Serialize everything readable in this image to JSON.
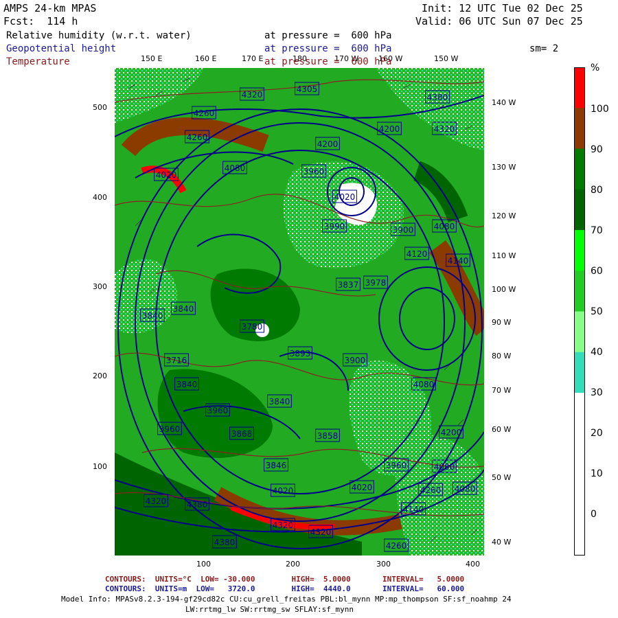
{
  "header": {
    "model": "AMPS 24-km MPAS",
    "fcst": "Fcst:  114 h",
    "init": "Init: 12 UTC Tue 02 Dec 25",
    "valid": "Valid: 06 UTC Sun 07 Dec 25",
    "rh_label": "Relative humidity (w.r.t. water)",
    "rh_level": "at pressure =  600 hPa",
    "gh_label": "Geopotential height",
    "gh_level": "at pressure =  600 hPa",
    "smooth": "sm= 2",
    "t_label": "Temperature",
    "t_level": "at pressure =  600 hPa"
  },
  "top_lon_labels": [
    "150 E",
    "160 E",
    "170 E",
    "180",
    "170 W",
    "160 W",
    "150 W"
  ],
  "right_lon_labels": [
    "140 W",
    "130 W",
    "120 W",
    "110 W",
    "100 W",
    "90 W",
    "80 W",
    "70 W",
    "60 W",
    "50 W",
    "40 W"
  ],
  "y_axis_labels": [
    "500",
    "400",
    "300",
    "200",
    "100"
  ],
  "x_axis_labels": [
    "100",
    "200",
    "300",
    "400"
  ],
  "height_labels": [
    "4320",
    "4305",
    "4380",
    "4260",
    "4200",
    "4320",
    "4260",
    "4200",
    "4020",
    "4080",
    "3960",
    "4020",
    "3990",
    "3900",
    "4080",
    "4120",
    "4140",
    "3840",
    "3780",
    "3978",
    "3837",
    "3840",
    "3716",
    "3840",
    "3893",
    "3900",
    "4080",
    "3840",
    "3960",
    "3960",
    "3868",
    "3858",
    "3846",
    "3960",
    "4200",
    "4080",
    "4020",
    "4020",
    "4260",
    "4320",
    "4380",
    "4320",
    "4260",
    "4380",
    "4140",
    "4080",
    "4320"
  ],
  "colorbar": {
    "unit": "%",
    "labels": [
      "100",
      "90",
      "80",
      "70",
      "60",
      "50",
      "40",
      "30",
      "20",
      "10",
      "0"
    ],
    "colors": [
      "#ff0000",
      "#8b3a00",
      "#007a00",
      "#006400",
      "#00ff00",
      "#22cc22",
      "#88ff88",
      "#33ddbb",
      "#ffffff",
      "#ffffff",
      "#ffffff",
      "#ffffff"
    ]
  },
  "footer": {
    "t_contours": "CONTOURS:  UNITS=°C  LOW= -30.000        HIGH=  5.0000       INTERVAL=   5.0000",
    "h_contours": "CONTOURS:  UNITS=m  LOW=   3720.0        HIGH=  4440.0       INTERVAL=   60.000",
    "model_info": "Model Info: MPASv8.2.3-194-gf29cd82c CU:cu_grell_freitas PBL:bl_mynn MP:mp_thompson SF:sf_noahmp 24",
    "model_info2": "LW:rrtmg_lw SW:rrtmg_sw SFLAY:sf_mynn"
  }
}
